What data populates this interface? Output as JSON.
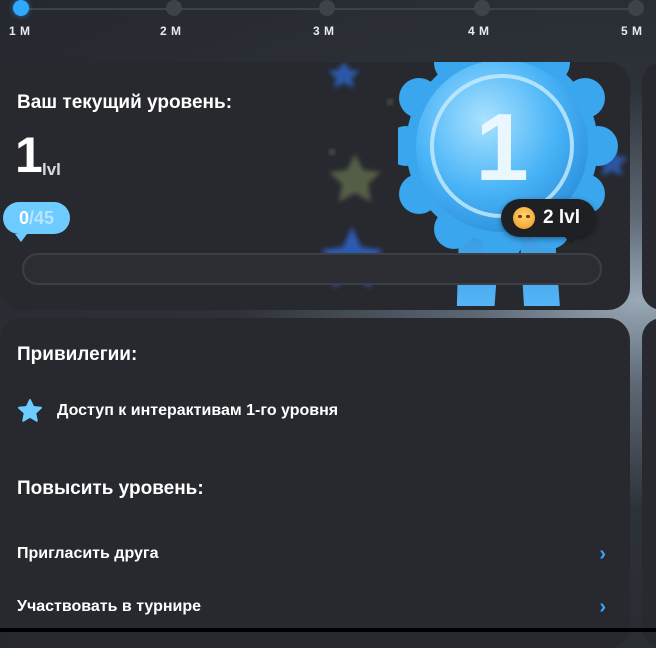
{
  "timeline": {
    "milestones": [
      {
        "label": "1 M",
        "active": true
      },
      {
        "label": "2 M",
        "active": false
      },
      {
        "label": "3 M",
        "active": false
      },
      {
        "label": "4 M",
        "active": false
      },
      {
        "label": "5 M",
        "active": false
      }
    ]
  },
  "level_card": {
    "title": "Ваш текущий уровень:",
    "level": "1",
    "level_suffix": "lvl",
    "progress_current": "0",
    "progress_total": "/45",
    "progress_fraction": 0,
    "next_level_label": "2 lvl",
    "medal_number": "1"
  },
  "privileges": {
    "title": "Привилегии:",
    "items": [
      {
        "label": "Доступ к интерактивам 1-го уровня",
        "icon": "star-icon"
      }
    ]
  },
  "upgrade": {
    "title": "Повысить уровень:",
    "actions": [
      {
        "label": "Пригласить друга"
      },
      {
        "label": "Участвовать в турнире"
      }
    ]
  },
  "colors": {
    "accent": "#30a8ff",
    "progress": "#6ecbff",
    "card": "#27292f"
  }
}
